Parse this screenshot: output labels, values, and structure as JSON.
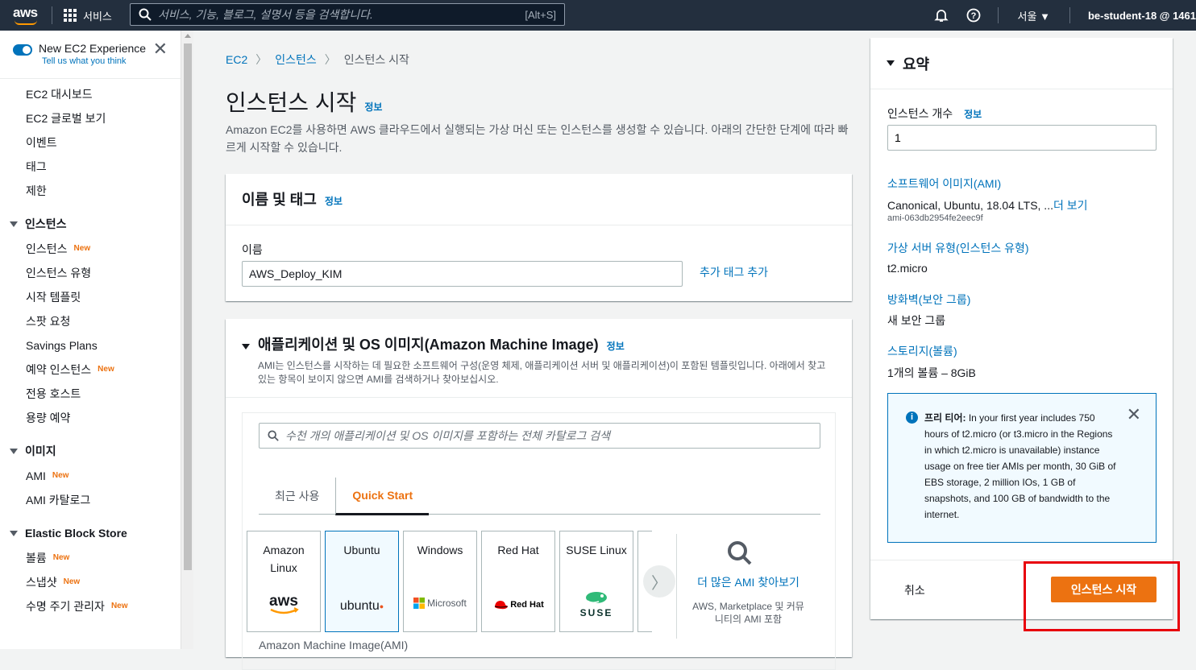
{
  "topnav": {
    "logo": "aws",
    "services_label": "서비스",
    "search_placeholder": "서비스, 기능, 블로그, 설명서 등을 검색합니다.",
    "search_shortcut": "[Alt+S]",
    "region": "서울 ▼",
    "account": "be-student-18 @ 1461"
  },
  "sidebar": {
    "new_exp_title": "New EC2 Experience",
    "new_exp_sub": "Tell us what you think",
    "new_badge": "New",
    "top_items": [
      "EC2 대시보드",
      "EC2 글로벌 보기",
      "이벤트",
      "태그",
      "제한"
    ],
    "sections": [
      {
        "title": "인스턴스",
        "items": [
          {
            "label": "인스턴스",
            "new": true
          },
          {
            "label": "인스턴스 유형",
            "new": false
          },
          {
            "label": "시작 템플릿",
            "new": false
          },
          {
            "label": "스팟 요청",
            "new": false
          },
          {
            "label": "Savings Plans",
            "new": false
          },
          {
            "label": "예약 인스턴스",
            "new": true
          },
          {
            "label": "전용 호스트",
            "new": false
          },
          {
            "label": "용량 예약",
            "new": false
          }
        ]
      },
      {
        "title": "이미지",
        "items": [
          {
            "label": "AMI",
            "new": true
          },
          {
            "label": "AMI 카탈로그",
            "new": false
          }
        ]
      },
      {
        "title": "Elastic Block Store",
        "items": [
          {
            "label": "볼륨",
            "new": true
          },
          {
            "label": "스냅샷",
            "new": true
          },
          {
            "label": "수명 주기 관리자",
            "new": true
          }
        ]
      }
    ]
  },
  "breadcrumb": {
    "items": [
      "EC2",
      "인스턴스"
    ],
    "current": "인스턴스 시작"
  },
  "page": {
    "title": "인스턴스 시작",
    "info": "정보",
    "description": "Amazon EC2를 사용하면 AWS 클라우드에서 실행되는 가상 머신 또는 인스턴스를 생성할 수 있습니다. 아래의 간단한 단계에 따라 빠르게 시작할 수 있습니다."
  },
  "name_tags": {
    "title": "이름 및 태그",
    "info": "정보",
    "name_label": "이름",
    "name_value": "AWS_Deploy_KIM",
    "add_tag": "추가 태그 추가"
  },
  "ami": {
    "title": "애플리케이션 및 OS 이미지(Amazon Machine Image)",
    "info": "정보",
    "description": "AMI는 인스턴스를 시작하는 데 필요한 소프트웨어 구성(운영 체제, 애플리케이션 서버 및 애플리케이션)이 포함된 템플릿입니다. 아래에서 찾고 있는 항목이 보이지 않으면 AMI를 검색하거나 찾아보십시오.",
    "search_placeholder": "수천 개의 애플리케이션 및 OS 이미지를 포함하는 전체 카탈로그 검색",
    "tabs": [
      "최근 사용",
      "Quick Start"
    ],
    "tiles": [
      {
        "name": "Amazon Linux",
        "logo": "aws"
      },
      {
        "name": "Ubuntu",
        "logo": "ubuntu"
      },
      {
        "name": "Windows",
        "logo": "Microsoft"
      },
      {
        "name": "Red Hat",
        "logo": "Red Hat"
      },
      {
        "name": "SUSE Linux",
        "logo": "SUSE"
      }
    ],
    "more_title": "더 많은 AMI 찾아보기",
    "more_sub": "AWS, Marketplace 및 커뮤니티의 AMI 포함",
    "footer_label": "Amazon Machine Image(AMI)"
  },
  "summary": {
    "title": "요약",
    "count_label": "인스턴스 개수",
    "count_info": "정보",
    "count_value": "1",
    "ami_link": "소프트웨어 이미지(AMI)",
    "ami_value": "Canonical, Ubuntu, 18.04 LTS, ...",
    "ami_more": "더 보기",
    "ami_id": "ami-063db2954fe2eec9f",
    "type_link": "가상 서버 유형(인스턴스 유형)",
    "type_value": "t2.micro",
    "fw_link": "방화벽(보안 그룹)",
    "fw_value": "새 보안 그룹",
    "storage_link": "스토리지(볼륨)",
    "storage_value": "1개의 볼륨 – 8GiB",
    "free_tier_title": "프리 티어:",
    "free_tier_text": " In your first year includes 750 hours of t2.micro (or t3.micro in the Regions in which t2.micro is unavailable) instance usage on free tier AMIs per month, 30 GiB of EBS storage, 2 million IOs, 1 GB of snapshots, and 100 GB of bandwidth to the internet.",
    "cancel": "취소",
    "launch": "인스턴스 시작"
  },
  "colors": {
    "accent": "#ec7211",
    "link": "#0073bb",
    "nav": "#232f3e",
    "highlight": "#e8000b"
  }
}
